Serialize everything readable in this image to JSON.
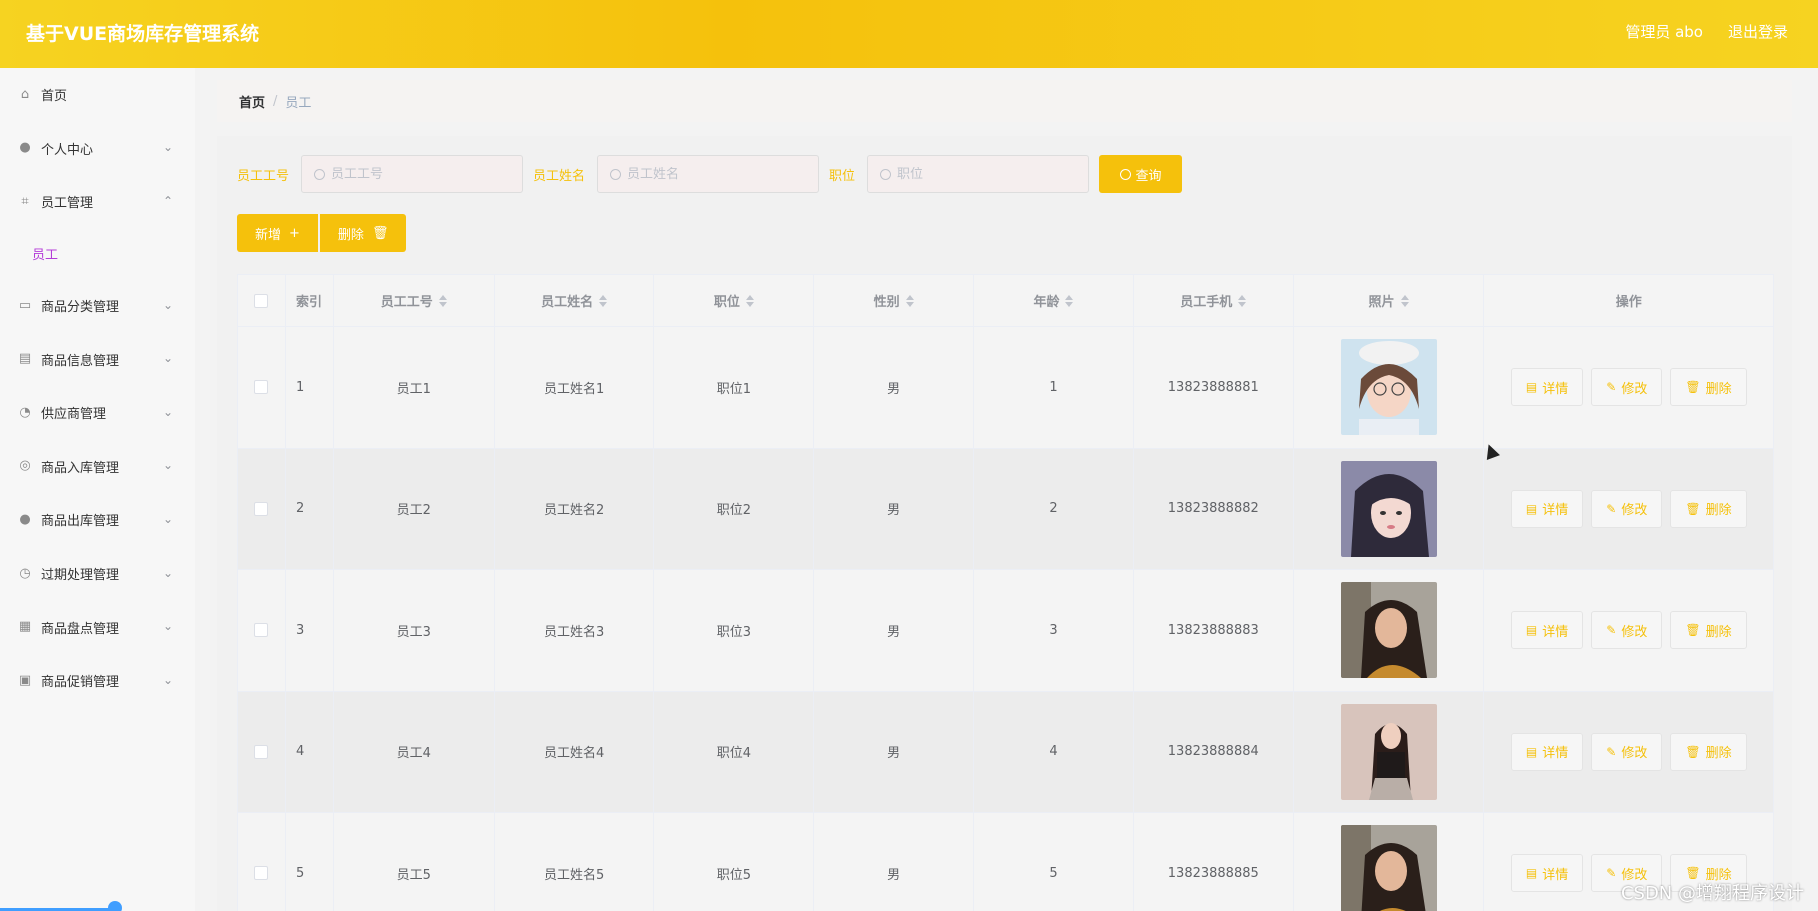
{
  "header": {
    "title": "基于VUE商场库存管理系统",
    "user": "管理员 abo",
    "logout": "退出登录"
  },
  "sidebar": {
    "items": [
      {
        "label": "首页",
        "icon": "home-icon"
      },
      {
        "label": "个人中心",
        "icon": "user-icon"
      },
      {
        "label": "员工管理",
        "icon": "crop-icon"
      },
      {
        "label": "商品分类管理",
        "icon": "tickets-icon"
      },
      {
        "label": "商品信息管理",
        "icon": "suitcase-icon"
      },
      {
        "label": "供应商管理",
        "icon": "compass-icon"
      },
      {
        "label": "商品入库管理",
        "icon": "help-icon"
      },
      {
        "label": "商品出库管理",
        "icon": "user-icon"
      },
      {
        "label": "过期处理管理",
        "icon": "time-icon"
      },
      {
        "label": "商品盘点管理",
        "icon": "grid-icon"
      },
      {
        "label": "商品促销管理",
        "icon": "clipboard-icon"
      }
    ],
    "sub": {
      "label": "员工"
    }
  },
  "breadcrumb": {
    "home": "首页",
    "current": "员工"
  },
  "search": {
    "no_label": "员工工号",
    "no_placeholder": "员工工号",
    "name_label": "员工姓名",
    "name_placeholder": "员工姓名",
    "pos_label": "职位",
    "pos_placeholder": "职位",
    "query": "查询"
  },
  "actions": {
    "add": "新增",
    "delete": "删除"
  },
  "table": {
    "headers": {
      "index": "索引",
      "no": "员工工号",
      "name": "员工姓名",
      "pos": "职位",
      "sex": "性别",
      "age": "年龄",
      "tel": "员工手机",
      "photo": "照片",
      "op": "操作"
    },
    "rows": [
      {
        "index": "1",
        "no": "员工1",
        "name": "员工姓名1",
        "pos": "职位1",
        "sex": "男",
        "age": "1",
        "tel": "13823888881"
      },
      {
        "index": "2",
        "no": "员工2",
        "name": "员工姓名2",
        "pos": "职位2",
        "sex": "男",
        "age": "2",
        "tel": "13823888882"
      },
      {
        "index": "3",
        "no": "员工3",
        "name": "员工姓名3",
        "pos": "职位3",
        "sex": "男",
        "age": "3",
        "tel": "13823888883"
      },
      {
        "index": "4",
        "no": "员工4",
        "name": "员工姓名4",
        "pos": "职位4",
        "sex": "男",
        "age": "4",
        "tel": "13823888884"
      },
      {
        "index": "5",
        "no": "员工5",
        "name": "员工姓名5",
        "pos": "职位5",
        "sex": "男",
        "age": "5",
        "tel": "13823888885"
      }
    ],
    "op": {
      "detail": "详情",
      "edit": "修改",
      "delete": "删除"
    }
  },
  "watermark": "CSDN @增翔程序设计",
  "colors": {
    "accent": "#f5c10c",
    "submenu": "#b43dd8"
  }
}
